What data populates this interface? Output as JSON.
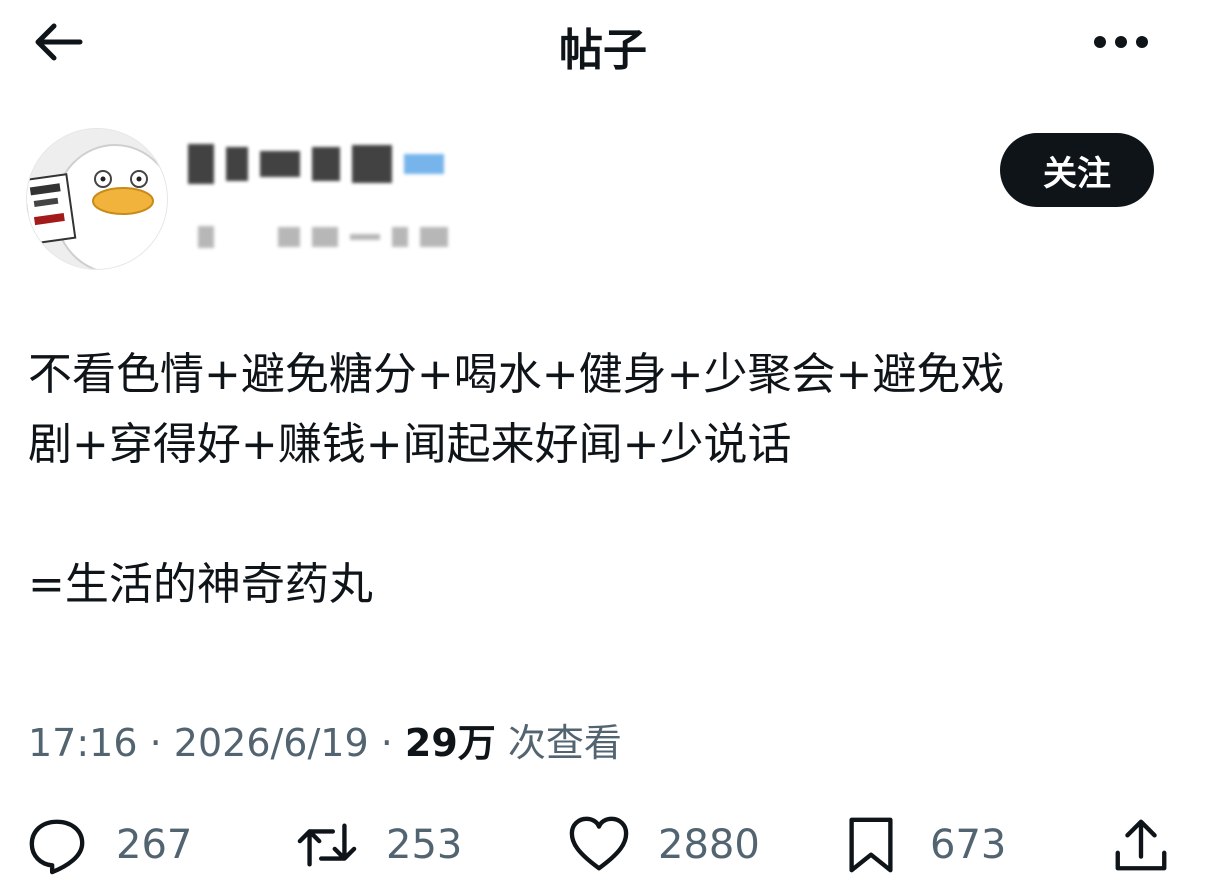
{
  "header": {
    "title": "帖子"
  },
  "follow_label": "关注",
  "post": {
    "lines": [
      "不看色情+避免糖分+喝水+健身+少聚会+避免戏",
      "剧+穿得好+赚钱+闻起来好闻+少说话",
      "",
      "=生活的神奇药丸"
    ]
  },
  "meta": {
    "time": "17:16",
    "date": "2026/6/19",
    "sep": "·",
    "views": "29万",
    "views_suffix": "次查看"
  },
  "actions": {
    "replies": "267",
    "reposts": "253",
    "likes": "2880",
    "bookmarks": "673"
  }
}
